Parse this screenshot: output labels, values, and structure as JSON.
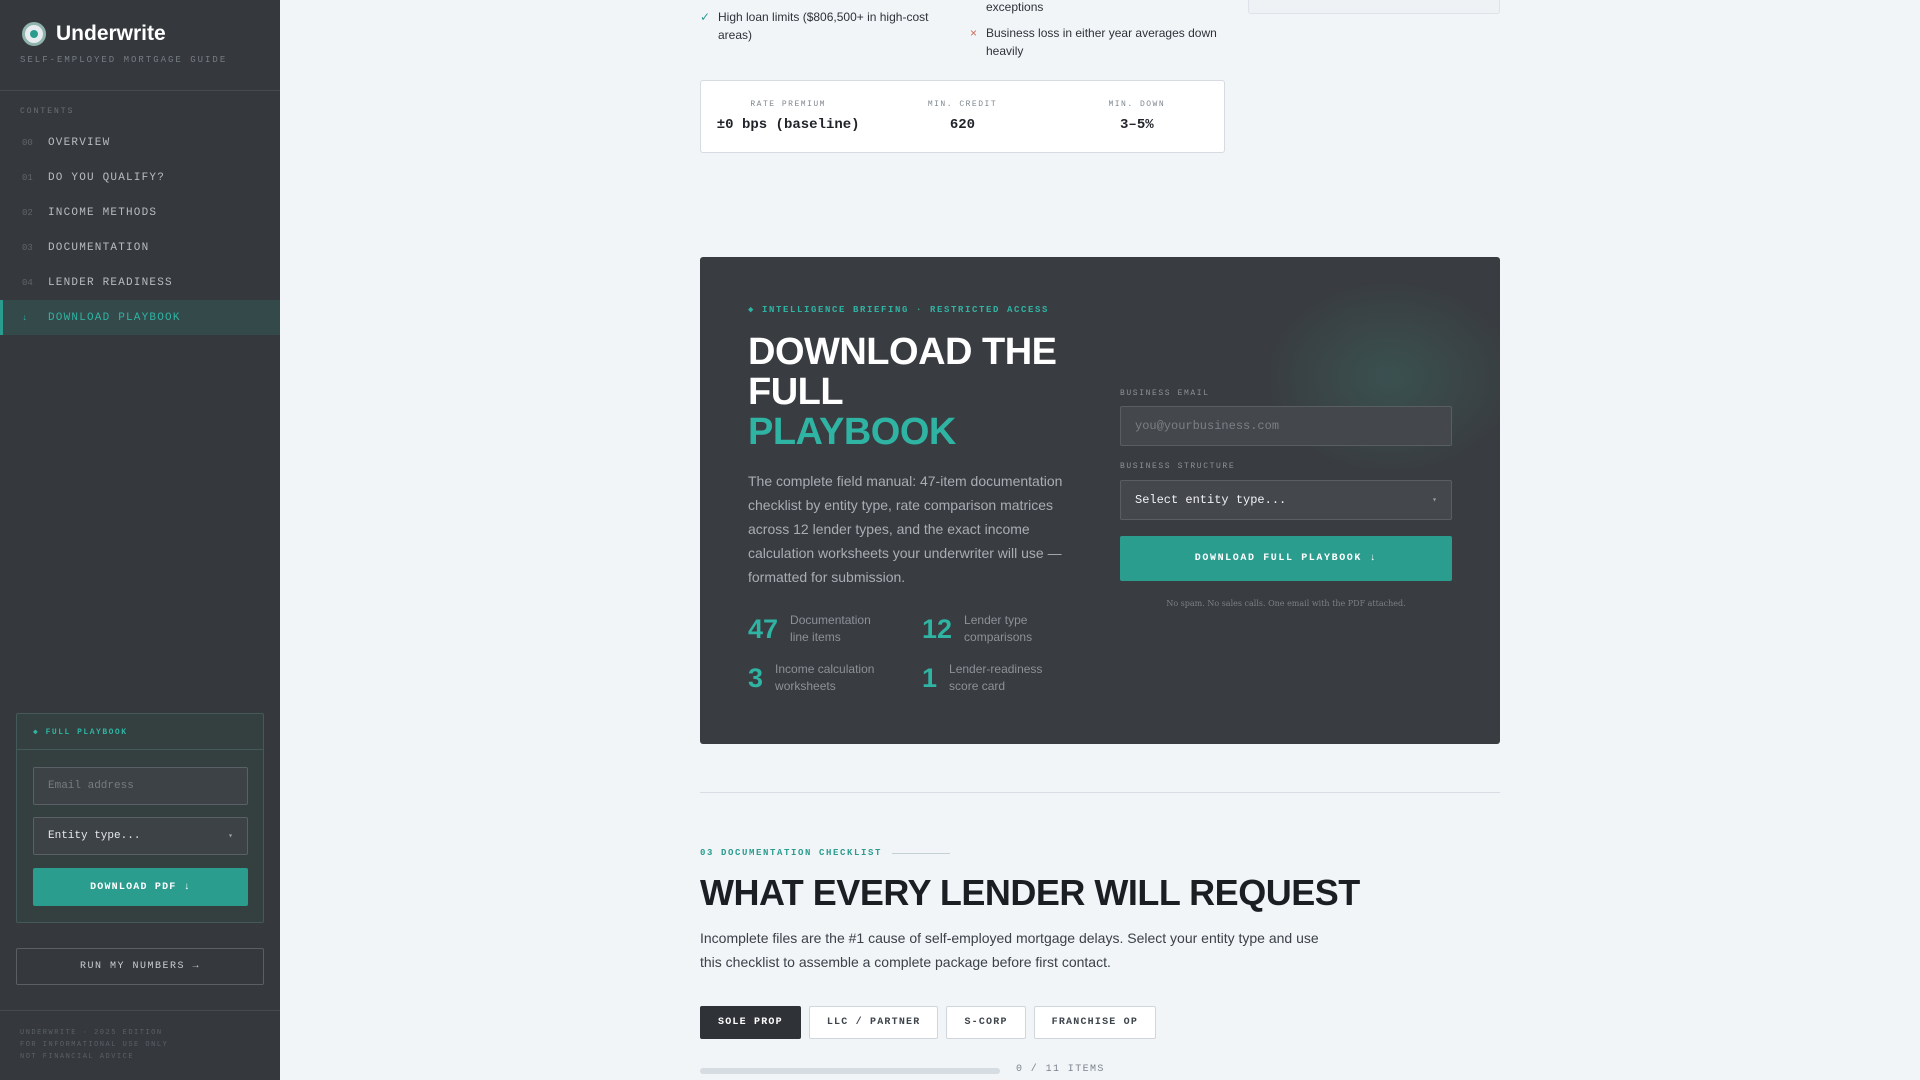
{
  "sidebar": {
    "brand_name": "Underwrite",
    "brand_sub": "SELF-EMPLOYED MORTGAGE GUIDE",
    "toc_label": "CONTENTS",
    "nav": [
      {
        "num": "00",
        "label": "OVERVIEW"
      },
      {
        "num": "01",
        "label": "DO YOU QUALIFY?"
      },
      {
        "num": "02",
        "label": "INCOME METHODS"
      },
      {
        "num": "03",
        "label": "DOCUMENTATION"
      },
      {
        "num": "04",
        "label": "LENDER READINESS"
      },
      {
        "num": "↓",
        "label": "DOWNLOAD PLAYBOOK"
      }
    ],
    "card": {
      "title": "◆ FULL PLAYBOOK",
      "email_placeholder": "Email address",
      "entity_value": "Entity type...",
      "button": "DOWNLOAD PDF ↓"
    },
    "run_button": "RUN MY NUMBERS →",
    "footer": [
      "UNDERWRITE · 2025 EDITION",
      "FOR INFORMATIONAL USE ONLY",
      "NOT FINANCIAL ADVICE"
    ]
  },
  "top": {
    "pro": "High loan limits ($806,500+ in high-cost areas)",
    "con_partial": "exceptions",
    "con": "Business loss in either year averages down heavily",
    "stats": [
      {
        "label": "RATE PREMIUM",
        "value": "±0 bps (baseline)"
      },
      {
        "label": "MIN. CREDIT",
        "value": "620"
      },
      {
        "label": "MIN. DOWN",
        "value": "3–5%"
      }
    ]
  },
  "briefing": {
    "eyebrow": "◆ INTELLIGENCE BRIEFING · RESTRICTED ACCESS",
    "title_line1": "DOWNLOAD THE",
    "title_line2": "FULL",
    "title_accent": "PLAYBOOK",
    "description": "The complete field manual: 47-item documentation checklist by entity type, rate comparison matrices across 12 lender types, and the exact income calculation worksheets your underwriter will use — formatted for submission.",
    "metrics": [
      {
        "num": "47",
        "text": "Documentation line items"
      },
      {
        "num": "12",
        "text": "Lender type comparisons"
      },
      {
        "num": "3",
        "text": "Income calculation worksheets"
      },
      {
        "num": "1",
        "text": "Lender-readiness score card"
      }
    ],
    "email_label": "BUSINESS EMAIL",
    "email_placeholder": "you@yourbusiness.com",
    "structure_label": "BUSINESS STRUCTURE",
    "structure_value": "Select entity type...",
    "button": "DOWNLOAD FULL PLAYBOOK ↓",
    "fine_print": "No spam. No sales calls. One email with the PDF attached."
  },
  "checklist": {
    "eyebrow": "03 DOCUMENTATION CHECKLIST",
    "title": "WHAT EVERY LENDER WILL REQUEST",
    "description": "Incomplete files are the #1 cause of self-employed mortgage delays. Select your entity type and use this checklist to assemble a complete package before first contact.",
    "tabs": [
      "SOLE PROP",
      "LLC / PARTNER",
      "S-CORP",
      "FRANCHISE OP"
    ],
    "progress_fraction": 0,
    "progress_label": "0 / 11 ITEMS"
  },
  "colors": {
    "accent": "#2a9d8f",
    "sidebar": "#35393e",
    "dark_card": "#393c40"
  }
}
